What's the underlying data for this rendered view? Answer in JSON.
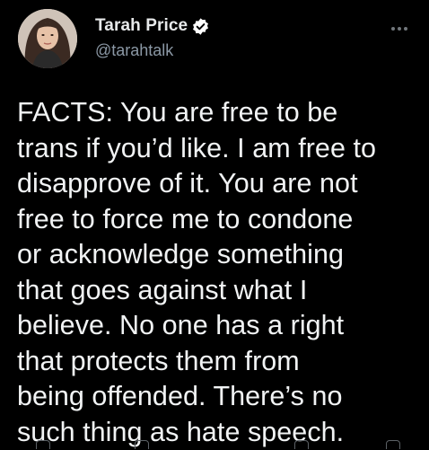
{
  "author": {
    "display_name": "Tarah Price",
    "handle": "@tarahtalk",
    "verified": true,
    "avatar_icon": "profile-photo"
  },
  "tweet": {
    "text": "FACTS: You are free to be\ntrans if you’d like. I am free to\ndisapprove of it. You are not\nfree to force me to condone\nor acknowledge something\nthat goes against what I\nbelieve. No one has a right\nthat protects them from\nbeing offended. There’s no\nsuch thing as hate speech."
  },
  "colors": {
    "background": "#000000",
    "text_primary": "#e7e9ea",
    "text_secondary": "#8b98a5",
    "verified_badge": "#ffffff"
  },
  "icons": {
    "more": "more-horizontal-icon",
    "verified": "verified-badge-icon",
    "actions": [
      "reply-icon",
      "retweet-icon",
      "like-icon",
      "share-icon"
    ]
  }
}
